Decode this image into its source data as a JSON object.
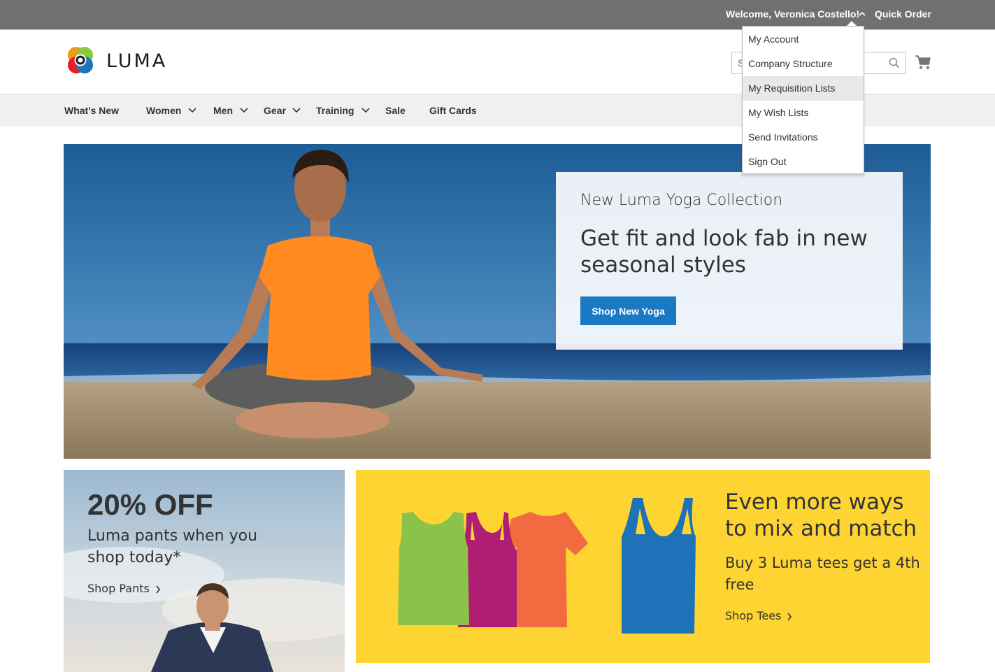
{
  "header": {
    "welcome": "Welcome, Veronica Costello!",
    "quick_order": "Quick Order",
    "logo_text": "LUMA",
    "search_placeholder": "S"
  },
  "account_menu": [
    {
      "label": "My Account"
    },
    {
      "label": "Company Structure"
    },
    {
      "label": "My Requisition Lists",
      "active": true
    },
    {
      "label": "My Wish Lists"
    },
    {
      "label": "Send Invitations"
    },
    {
      "label": "Sign Out"
    }
  ],
  "nav": [
    {
      "label": "What's New",
      "has_submenu": false
    },
    {
      "label": "Women",
      "has_submenu": true
    },
    {
      "label": "Men",
      "has_submenu": true
    },
    {
      "label": "Gear",
      "has_submenu": true
    },
    {
      "label": "Training",
      "has_submenu": true
    },
    {
      "label": "Sale",
      "has_submenu": false
    },
    {
      "label": "Gift Cards",
      "has_submenu": false
    }
  ],
  "hero": {
    "subtitle": "New Luma Yoga Collection",
    "title": "Get fit and look fab in new seasonal styles",
    "button": "Shop New Yoga"
  },
  "promo_pants": {
    "headline": "20% OFF",
    "description": "Luma pants when you shop today*",
    "link": "Shop Pants"
  },
  "promo_tees": {
    "headline": "Even more ways to mix and match",
    "description": "Buy 3 Luma tees get a 4th free",
    "link": "Shop Tees"
  },
  "colors": {
    "panel_bg": "#6e716e",
    "nav_bg": "#f0f0f0",
    "primary_button": "#1979c3",
    "tees_bg": "#fdd432",
    "tee_green": "#8bc34a",
    "tee_magenta": "#b01e74",
    "tee_orange": "#f26a3f",
    "tank_blue": "#1e72b8"
  },
  "icons": [
    "chevron-up-icon",
    "search-icon",
    "cart-icon",
    "chevron-down-icon",
    "chevron-right-icon",
    "luma-logo"
  ]
}
